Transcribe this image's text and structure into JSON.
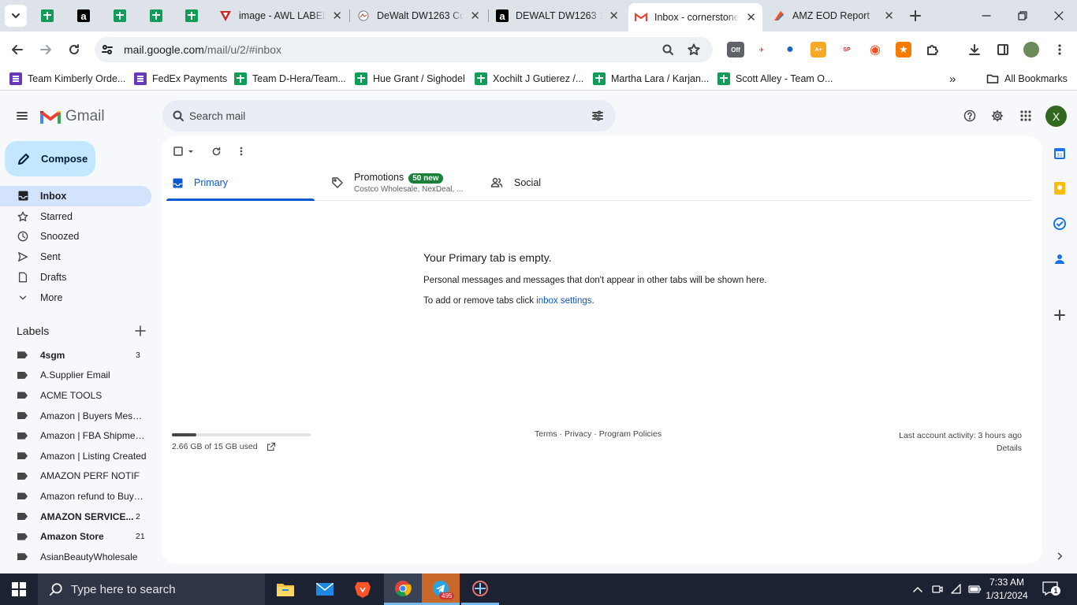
{
  "browser": {
    "tabs": [
      {
        "title": "image - AWL LABEL",
        "icon": "awl-triangle-icon",
        "active": false
      },
      {
        "title": "DeWalt DW1263 Col",
        "icon": "product-image-icon",
        "active": false
      },
      {
        "title": "DEWALT DW1263 14",
        "icon": "amazon-icon",
        "active": false
      },
      {
        "title": "Inbox - cornerstone",
        "icon": "gmail-icon",
        "active": true
      },
      {
        "title": "AMZ EOD Report",
        "icon": "report-icon",
        "active": false
      }
    ],
    "pinned_tab_icons": [
      "sheets-icon",
      "amazon-icon",
      "sheets-icon",
      "sheets-icon",
      "sheets-icon"
    ],
    "url_host": "mail.google.com",
    "url_path": "/mail/u/2/#inbox",
    "extension_badge": "Off",
    "bookmarks": [
      {
        "label": "Team Kimberly Orde...",
        "icon": "purple-form-icon"
      },
      {
        "label": "FedEx Payments",
        "icon": "purple-form-icon"
      },
      {
        "label": "Team D-Hera/Team...",
        "icon": "sheets-icon"
      },
      {
        "label": "Hue Grant / Sighodel",
        "icon": "sheets-icon"
      },
      {
        "label": "Xochilt J Gutierez /...",
        "icon": "sheets-icon"
      },
      {
        "label": "Martha Lara / Karjan...",
        "icon": "sheets-icon"
      },
      {
        "label": "Scott Alley - Team O...",
        "icon": "sheets-icon"
      }
    ],
    "all_bookmarks": "All Bookmarks"
  },
  "gmail": {
    "logo_text": "Gmail",
    "search_placeholder": "Search mail",
    "avatar_initial": "X",
    "compose": "Compose",
    "nav": [
      {
        "label": "Inbox",
        "icon": "inbox-icon",
        "selected": true
      },
      {
        "label": "Starred",
        "icon": "star-icon",
        "selected": false
      },
      {
        "label": "Snoozed",
        "icon": "clock-icon",
        "selected": false
      },
      {
        "label": "Sent",
        "icon": "send-icon",
        "selected": false
      },
      {
        "label": "Drafts",
        "icon": "draft-icon",
        "selected": false
      },
      {
        "label": "More",
        "icon": "chevron-down-icon",
        "selected": false
      }
    ],
    "labels_title": "Labels",
    "labels": [
      {
        "name": "4sgm",
        "count": "3",
        "bold": true
      },
      {
        "name": "A.Supplier Email",
        "count": "",
        "bold": false
      },
      {
        "name": "ACME TOOLS",
        "count": "",
        "bold": false
      },
      {
        "name": "Amazon | Buyers Messag...",
        "count": "",
        "bold": false
      },
      {
        "name": "Amazon | FBA Shipments",
        "count": "",
        "bold": false
      },
      {
        "name": "Amazon | Listing Created",
        "count": "",
        "bold": false
      },
      {
        "name": "AMAZON PERF NOTIF",
        "count": "",
        "bold": false
      },
      {
        "name": "Amazon refund to Buyers",
        "count": "",
        "bold": false
      },
      {
        "name": "AMAZON SERVICE...",
        "count": "2",
        "bold": true
      },
      {
        "name": "Amazon Store",
        "count": "21",
        "bold": true
      },
      {
        "name": "AsianBeautyWholesale",
        "count": "",
        "bold": false
      }
    ],
    "category_tabs": {
      "primary": "Primary",
      "promotions": "Promotions",
      "promotions_badge": "50 new",
      "promotions_senders": "Costco Wholesale, NexDeal, ...",
      "social": "Social"
    },
    "empty_state": {
      "title": "Your Primary tab is empty.",
      "line1": "Personal messages and messages that don't appear in other tabs will be shown here.",
      "line2_prefix": "To add or remove tabs click ",
      "line2_link": "inbox settings",
      "line2_suffix": "."
    },
    "footer": {
      "storage": "2.66 GB of 15 GB used",
      "storage_fraction": 0.177,
      "terms": "Terms",
      "privacy": "Privacy",
      "policies": "Program Policies",
      "sep": "·",
      "last_activity": "Last account activity: 3 hours ago",
      "details": "Details"
    }
  },
  "taskbar": {
    "search_placeholder": "Type here to search",
    "telegram_badge": "495",
    "time": "7:33 AM",
    "date": "1/31/2024",
    "notification_count": "1"
  }
}
